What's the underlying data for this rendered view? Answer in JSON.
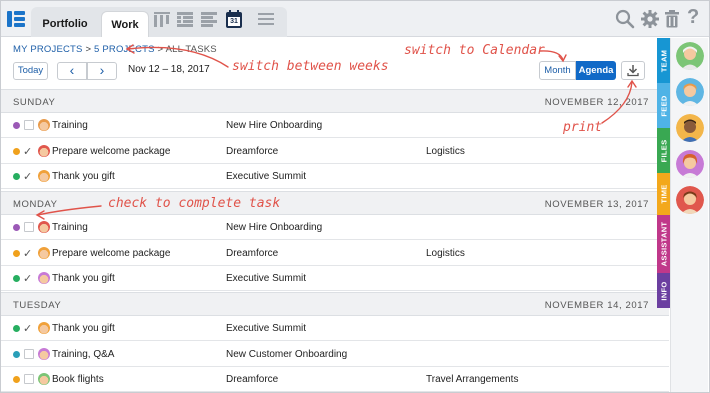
{
  "toolbar": {
    "tabs": [
      {
        "label": "Portfolio"
      },
      {
        "label": "Work"
      }
    ],
    "calendar_day": "31",
    "icons": [
      "app-icon",
      "columns-icon",
      "outline-icon",
      "list-icon",
      "calendar-icon",
      "menu-icon",
      "search-icon",
      "gear-icon",
      "trash-icon",
      "help-icon"
    ]
  },
  "header": {
    "breadcrumb": {
      "level1": "MY PROJECTS",
      "sep1": ">",
      "level2": "5 PROJECTS",
      "sep2": ">",
      "current": "ALL TASKS"
    },
    "today_label": "Today",
    "prev_icon": "‹",
    "next_icon": "›",
    "date_range": "Nov 12 – 18, 2017",
    "view_month": "Month",
    "view_agenda": "Agenda",
    "print_icon": "download-icon"
  },
  "days": [
    {
      "name": "SUNDAY",
      "date": "NOVEMBER 12, 2017",
      "tasks": [
        {
          "task": "Training",
          "project": "New Hire Onboarding",
          "category": "",
          "dot_color": "#9b59b6",
          "done": false
        },
        {
          "task": "Prepare welcome package",
          "project": "Dreamforce",
          "category": "Logistics",
          "dot_color": "#f0a11c",
          "done": true
        },
        {
          "task": "Thank you gift",
          "project": "Executive Summit",
          "category": "",
          "dot_color": "#27ae60",
          "done": true
        }
      ]
    },
    {
      "name": "MONDAY",
      "date": "NOVEMBER 13, 2017",
      "tasks": [
        {
          "task": "Training",
          "project": "New Hire Onboarding",
          "category": "",
          "dot_color": "#9b59b6",
          "done": false
        },
        {
          "task": "Prepare welcome package",
          "project": "Dreamforce",
          "category": "Logistics",
          "dot_color": "#f0a11c",
          "done": true
        },
        {
          "task": "Thank you gift",
          "project": "Executive Summit",
          "category": "",
          "dot_color": "#27ae60",
          "done": true
        }
      ]
    },
    {
      "name": "TUESDAY",
      "date": "NOVEMBER 14, 2017",
      "tasks": [
        {
          "task": "Thank you gift",
          "project": "Executive Summit",
          "category": "",
          "dot_color": "#27ae60",
          "done": true
        },
        {
          "task": "Training, Q&A",
          "project": "New Customer Onboarding",
          "category": "",
          "dot_color": "#2a9fb8",
          "done": false
        },
        {
          "task": "Book flights",
          "project": "Dreamforce",
          "category": "Travel Arrangements",
          "dot_color": "#f0a11c",
          "done": false
        }
      ]
    }
  ],
  "side_tabs": [
    {
      "label": "TEAM",
      "color": "#1796d3"
    },
    {
      "label": "FEED",
      "color": "#4fb3e6"
    },
    {
      "label": "FILES",
      "color": "#39a852"
    },
    {
      "label": "TIME",
      "color": "#f3a81c"
    },
    {
      "label": "ASSISTANT",
      "color": "#c0388a"
    },
    {
      "label": "INFO",
      "color": "#6b3fa0"
    }
  ],
  "annotations": {
    "switch_weeks": "switch between weeks",
    "switch_calendar": "switch to Calendar",
    "print": "print",
    "check_complete": "check to complete task"
  }
}
